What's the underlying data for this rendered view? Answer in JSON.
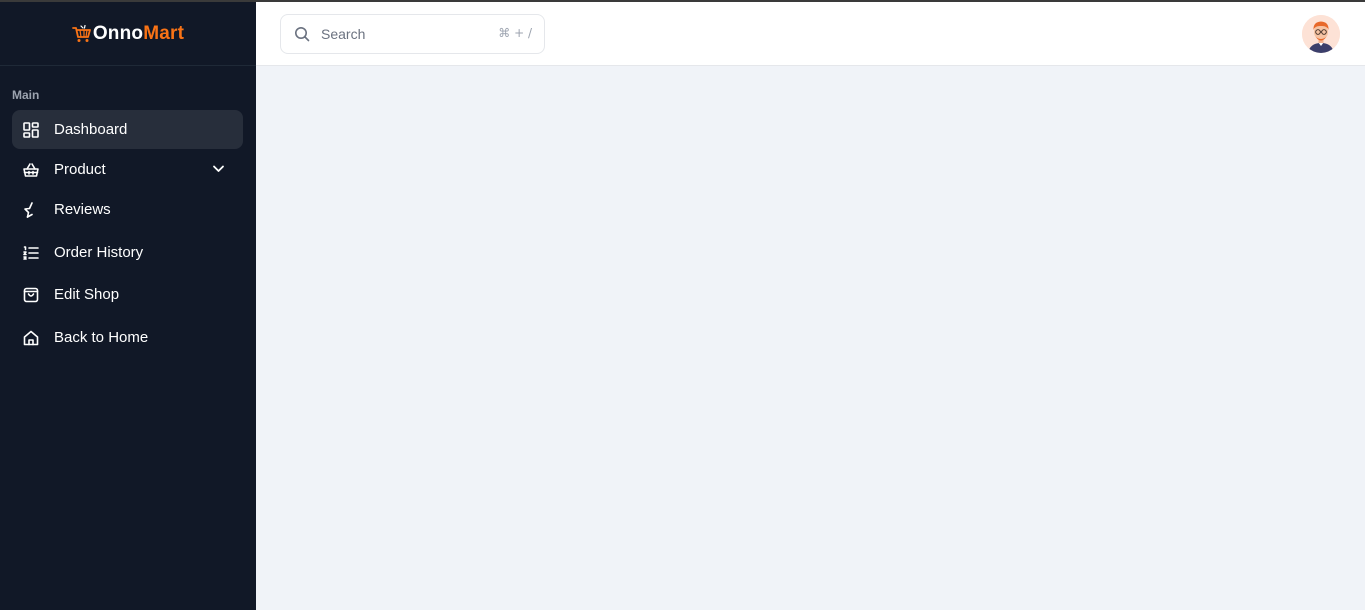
{
  "brand": {
    "name_part1": "Onno",
    "name_part2": "Mart",
    "accent": "#f97316",
    "logo_icon": "cart-icon"
  },
  "sidebar": {
    "section_label": "Main",
    "items": [
      {
        "label": "Dashboard",
        "icon": "dashboard-icon",
        "active": true
      },
      {
        "label": "Product",
        "icon": "basket-icon",
        "has_submenu": true
      },
      {
        "label": "Reviews",
        "icon": "star-half-icon"
      },
      {
        "label": "Order History",
        "icon": "list-icon"
      },
      {
        "label": "Edit Shop",
        "icon": "shopping-bag-icon"
      },
      {
        "label": "Back to Home",
        "icon": "home-icon"
      }
    ]
  },
  "topbar": {
    "search": {
      "placeholder": "Search",
      "shortcut": "⌘ + /"
    },
    "avatar_icon": "user-avatar"
  },
  "colors": {
    "sidebar_bg": "#111827",
    "active_item_bg": "#272e3b",
    "main_bg": "#f0f3f8"
  }
}
